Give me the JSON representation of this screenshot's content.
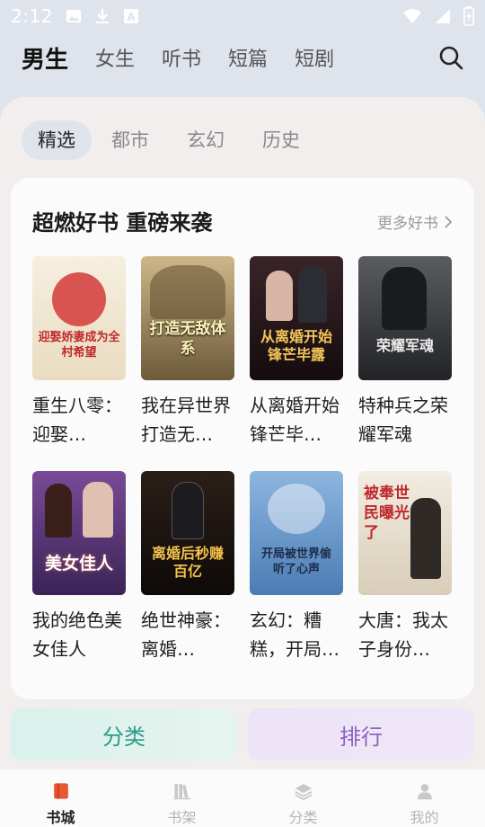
{
  "status_bar": {
    "time": "2:12"
  },
  "top_tabs": [
    "男生",
    "女生",
    "听书",
    "短篇",
    "短剧"
  ],
  "sub_tabs": [
    "精选",
    "都市",
    "玄幻",
    "历史"
  ],
  "section": {
    "title": "超燃好书 重磅来袭",
    "more": "更多好书"
  },
  "books": [
    {
      "title": "重生八零：迎娶…",
      "cover_text": "迎娶娇妻成为全村希望",
      "cover_bg": "#f3ead8",
      "accent": "#c0282c"
    },
    {
      "title": "我在异世界打造无…",
      "cover_text": "打造无敌体系",
      "cover_bg": "#b9a57a",
      "accent": "#fff6c8"
    },
    {
      "title": "从离婚开始锋芒毕…",
      "cover_text": "从离婚开始锋芒毕露",
      "cover_bg": "#2a1a20",
      "accent": "#f3c55a"
    },
    {
      "title": "特种兵之荣耀军魂",
      "cover_text": "荣耀军魂",
      "cover_bg": "#3b3c3e",
      "accent": "#e9e9e9"
    },
    {
      "title": "我的绝色美女佳人",
      "cover_text": "美女佳人",
      "cover_bg": "#5a3a7a",
      "accent": "#ffffff"
    },
    {
      "title": "绝世神豪：离婚…",
      "cover_text": "离婚后秒赚百亿",
      "cover_bg": "#1c1410",
      "accent": "#f4c24a"
    },
    {
      "title": "玄幻：糟糕，开局…",
      "cover_text": "开局被世界偷听了心声",
      "cover_bg": "#5d8ec4",
      "accent": "#1d2b46"
    },
    {
      "title": "大唐：我太子身份…",
      "cover_text": "被奉世民曝光了",
      "cover_bg": "#e9e3d6",
      "accent": "#c0282c"
    }
  ],
  "quick_buttons": {
    "fenlei": "分类",
    "paihang": "排行"
  },
  "bottom_nav": [
    "书城",
    "书架",
    "分类",
    "我的"
  ]
}
